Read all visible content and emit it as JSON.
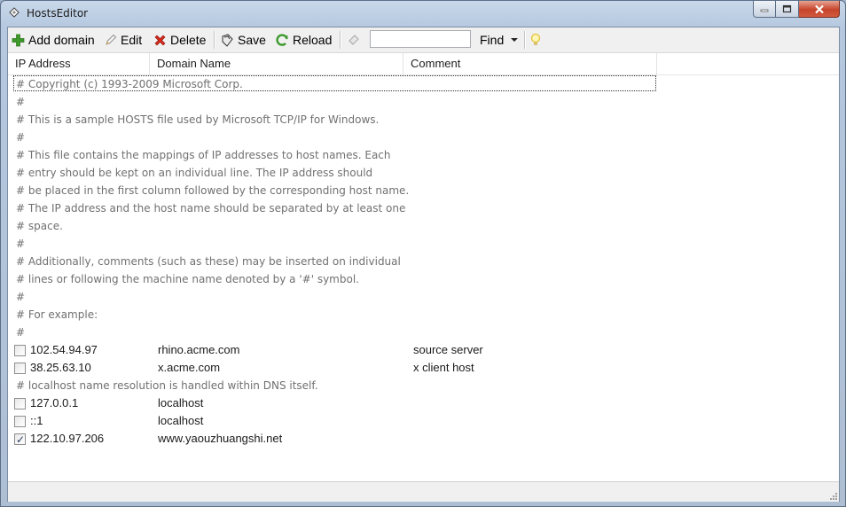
{
  "window": {
    "title": "HostsEditor"
  },
  "toolbar": {
    "add_label": "Add domain",
    "edit_label": "Edit",
    "delete_label": "Delete",
    "save_label": "Save",
    "reload_label": "Reload",
    "find_value": "",
    "find_label": "Find"
  },
  "columns": {
    "ip": "IP Address",
    "domain": "Domain Name",
    "comment": "Comment"
  },
  "rows": [
    {
      "type": "comment",
      "text": "# Copyright (c) 1993-2009 Microsoft Corp."
    },
    {
      "type": "comment",
      "text": "#"
    },
    {
      "type": "comment",
      "text": "# This is a sample HOSTS file used by Microsoft TCP/IP for Windows."
    },
    {
      "type": "comment",
      "text": "#"
    },
    {
      "type": "comment",
      "text": "# This file contains the mappings of IP addresses to host names. Each"
    },
    {
      "type": "comment",
      "text": "# entry should be kept on an individual line. The IP address should"
    },
    {
      "type": "comment",
      "text": "# be placed in the first column followed by the corresponding host name."
    },
    {
      "type": "comment",
      "text": "# The IP address and the host name should be separated by at least one"
    },
    {
      "type": "comment",
      "text": "# space."
    },
    {
      "type": "comment",
      "text": "#"
    },
    {
      "type": "comment",
      "text": "# Additionally, comments (such as these) may be inserted on individual"
    },
    {
      "type": "comment",
      "text": "# lines or following the machine name denoted by a '#' symbol."
    },
    {
      "type": "comment",
      "text": "#"
    },
    {
      "type": "comment",
      "text": "# For example:"
    },
    {
      "type": "comment",
      "text": "#"
    },
    {
      "type": "entry",
      "checked": false,
      "ip": "102.54.94.97",
      "domain": "rhino.acme.com",
      "comment": "source server"
    },
    {
      "type": "entry",
      "checked": false,
      "ip": "38.25.63.10",
      "domain": "x.acme.com",
      "comment": "x client host"
    },
    {
      "type": "comment",
      "text": "# localhost name resolution is handled within DNS itself."
    },
    {
      "type": "entry",
      "checked": false,
      "ip": "127.0.0.1",
      "domain": "localhost",
      "comment": ""
    },
    {
      "type": "entry",
      "checked": false,
      "ip": "::1",
      "domain": "localhost",
      "comment": ""
    },
    {
      "type": "entry",
      "checked": true,
      "ip": "122.10.97.206",
      "domain": "www.yaouzhuangshi.net",
      "comment": ""
    }
  ]
}
